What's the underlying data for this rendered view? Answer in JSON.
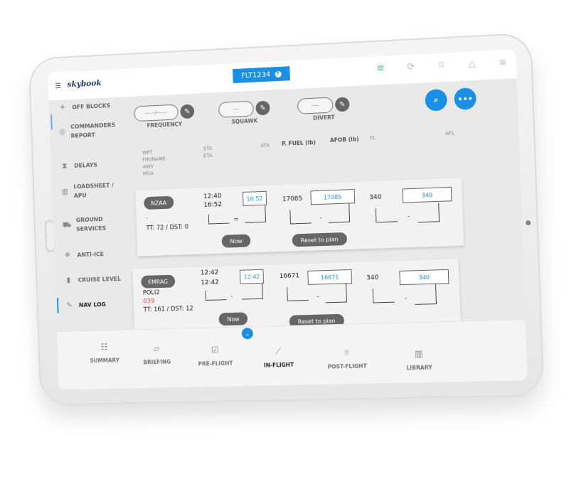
{
  "app": {
    "logo": "skybook",
    "flight_badge": "FLT1234",
    "flight_badge_info": "?"
  },
  "top_icons": [
    "wifi-icon",
    "sync-icon",
    "bookmark-icon",
    "bell-icon",
    "settings-sliders-icon"
  ],
  "sidebar": {
    "items": [
      {
        "label": "OFF BLOCKS",
        "icon": "plane-takeoff-icon"
      },
      {
        "label": "COMMANDERS REPORT",
        "icon": "report-icon"
      },
      {
        "label": "DELAYS",
        "icon": "hourglass-icon"
      },
      {
        "label": "LOADSHEET / APU",
        "icon": "luggage-icon"
      },
      {
        "label": "GROUND SERVICES",
        "icon": "ground-services-icon"
      },
      {
        "label": "ANTI-ICE",
        "icon": "snowflake-icon"
      },
      {
        "label": "CRUISE LEVEL",
        "icon": "ruler-icon"
      },
      {
        "label": "NAV LOG",
        "icon": "edit-icon",
        "active": true
      }
    ]
  },
  "fields": {
    "frequency": {
      "label": "FREQUENCY",
      "placeholder": "---.--/---.--"
    },
    "squawk": {
      "label": "SQUAWK",
      "placeholder": "----"
    },
    "divert": {
      "label": "DIVERT",
      "placeholder": "----"
    }
  },
  "columns": {
    "wpt": [
      "WPT",
      "FIR/NAME",
      "AWY",
      "MSA"
    ],
    "sta_eta": [
      "STA",
      "ETA"
    ],
    "ata": "ATA",
    "pfuel": "P. FUEL (lb)",
    "afob": "AFOB (lb)",
    "fl": "FL",
    "afl": "AFL"
  },
  "rows": [
    {
      "wpt": "NZAA",
      "fir_name": ".",
      "awy": "",
      "tt_dst": "TT: 72 / DST: 0",
      "sta": "12:40",
      "eta": "16:52",
      "ata": "16:52",
      "sep": "=",
      "pfuel": "17085",
      "afob": "17085",
      "fl": "340",
      "afl": "340",
      "now_label": "Now",
      "reset_label": "Reset to plan"
    },
    {
      "wpt": "EMRAG",
      "fir_name": "POLI2",
      "awy": "039",
      "tt_dst": "TT: 161 / DST: 12",
      "sta": "12:42",
      "eta": "12:42",
      "ata": "12:42",
      "sep": "-",
      "pfuel": "16671",
      "afob": "16671",
      "fl": "340",
      "afl": "340",
      "now_label": "Now",
      "reset_label": "Reset to plan"
    }
  ],
  "bottom_nav": [
    {
      "label": "SUMMARY",
      "icon": "list-icon"
    },
    {
      "label": "BRIEFING",
      "icon": "map-icon"
    },
    {
      "label": "PRE-FLIGHT",
      "icon": "checklist-icon"
    },
    {
      "label": "IN-FLIGHT",
      "icon": "route-icon",
      "active": true
    },
    {
      "label": "POST-FLIGHT",
      "icon": "location-pin-icon"
    },
    {
      "label": "LIBRARY",
      "icon": "books-icon"
    }
  ],
  "colors": {
    "accent": "#1a8fe3",
    "wifi": "#3cbf7a",
    "alert": "#e04545",
    "dark_pill": "#666666"
  }
}
